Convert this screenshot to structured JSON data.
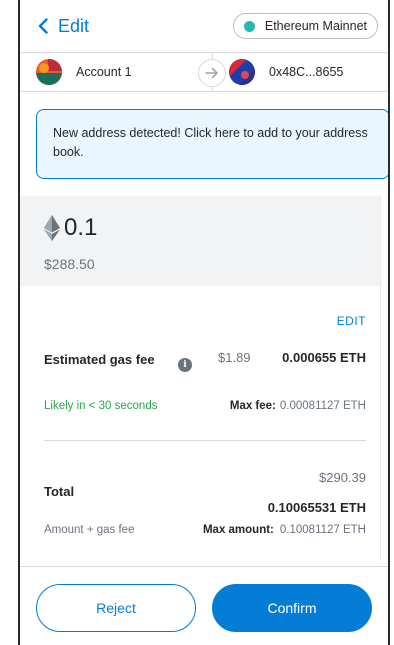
{
  "header": {
    "back_label": "Edit",
    "network_label": "Ethereum Mainnet"
  },
  "accounts": {
    "from_name": "Account 1",
    "to_address": "0x48C...8655"
  },
  "alert": {
    "text": "New address detected! Click here to add to your address book."
  },
  "amount": {
    "eth": "0.1",
    "usd": "$288.50"
  },
  "gas": {
    "edit_label": "EDIT",
    "title": "Estimated gas fee",
    "usd": "$1.89",
    "eth": "0.000655 ETH",
    "likely": "Likely in < 30 seconds",
    "max_fee_label": "Max fee:",
    "max_fee_value": "0.00081127 ETH"
  },
  "total": {
    "label": "Total",
    "usd": "$290.39",
    "eth": "0.10065531 ETH",
    "subtitle": "Amount + gas fee",
    "max_amount_label": "Max amount:",
    "max_amount_value": "0.10081127 ETH"
  },
  "footer": {
    "reject_label": "Reject",
    "confirm_label": "Confirm"
  },
  "colors": {
    "primary": "#037dd6",
    "network_dot": "#29b6af",
    "success": "#28a745",
    "alert_bg": "#eaf6ff"
  }
}
